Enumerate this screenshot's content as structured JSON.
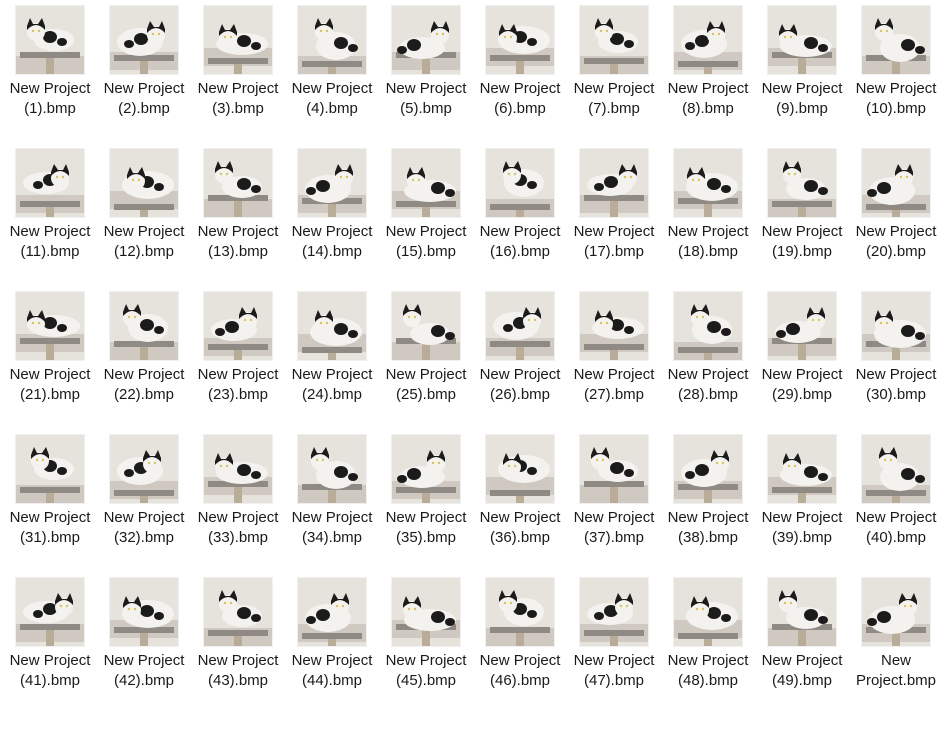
{
  "files": [
    {
      "name": "New Project (1).bmp",
      "thumb_icon": "cat-photo-icon"
    },
    {
      "name": "New Project (2).bmp",
      "thumb_icon": "cat-photo-icon"
    },
    {
      "name": "New Project (3).bmp",
      "thumb_icon": "cat-photo-icon"
    },
    {
      "name": "New Project (4).bmp",
      "thumb_icon": "cat-photo-icon"
    },
    {
      "name": "New Project (5).bmp",
      "thumb_icon": "cat-photo-icon"
    },
    {
      "name": "New Project (6).bmp",
      "thumb_icon": "cat-photo-icon"
    },
    {
      "name": "New Project (7).bmp",
      "thumb_icon": "cat-photo-icon"
    },
    {
      "name": "New Project (8).bmp",
      "thumb_icon": "cat-photo-icon"
    },
    {
      "name": "New Project (9).bmp",
      "thumb_icon": "cat-photo-icon"
    },
    {
      "name": "New Project (10).bmp",
      "thumb_icon": "cat-photo-icon"
    },
    {
      "name": "New Project (11).bmp",
      "thumb_icon": "cat-photo-icon"
    },
    {
      "name": "New Project (12).bmp",
      "thumb_icon": "cat-photo-icon"
    },
    {
      "name": "New Project (13).bmp",
      "thumb_icon": "cat-photo-icon"
    },
    {
      "name": "New Project (14).bmp",
      "thumb_icon": "cat-photo-icon"
    },
    {
      "name": "New Project (15).bmp",
      "thumb_icon": "cat-photo-icon"
    },
    {
      "name": "New Project (16).bmp",
      "thumb_icon": "cat-photo-icon"
    },
    {
      "name": "New Project (17).bmp",
      "thumb_icon": "cat-photo-icon"
    },
    {
      "name": "New Project (18).bmp",
      "thumb_icon": "cat-photo-icon"
    },
    {
      "name": "New Project (19).bmp",
      "thumb_icon": "cat-photo-icon"
    },
    {
      "name": "New Project (20).bmp",
      "thumb_icon": "cat-photo-icon"
    },
    {
      "name": "New Project (21).bmp",
      "thumb_icon": "cat-photo-icon"
    },
    {
      "name": "New Project (22).bmp",
      "thumb_icon": "cat-photo-icon"
    },
    {
      "name": "New Project (23).bmp",
      "thumb_icon": "cat-photo-icon"
    },
    {
      "name": "New Project (24).bmp",
      "thumb_icon": "cat-photo-icon"
    },
    {
      "name": "New Project (25).bmp",
      "thumb_icon": "cat-photo-icon"
    },
    {
      "name": "New Project (26).bmp",
      "thumb_icon": "cat-photo-icon"
    },
    {
      "name": "New Project (27).bmp",
      "thumb_icon": "cat-photo-icon"
    },
    {
      "name": "New Project (28).bmp",
      "thumb_icon": "cat-photo-icon"
    },
    {
      "name": "New Project (29).bmp",
      "thumb_icon": "cat-photo-icon"
    },
    {
      "name": "New Project (30).bmp",
      "thumb_icon": "cat-photo-icon"
    },
    {
      "name": "New Project (31).bmp",
      "thumb_icon": "cat-photo-icon"
    },
    {
      "name": "New Project (32).bmp",
      "thumb_icon": "cat-photo-icon"
    },
    {
      "name": "New Project (33).bmp",
      "thumb_icon": "cat-photo-icon"
    },
    {
      "name": "New Project (34).bmp",
      "thumb_icon": "cat-photo-icon"
    },
    {
      "name": "New Project (35).bmp",
      "thumb_icon": "cat-photo-icon"
    },
    {
      "name": "New Project (36).bmp",
      "thumb_icon": "cat-photo-icon"
    },
    {
      "name": "New Project (37).bmp",
      "thumb_icon": "cat-photo-icon"
    },
    {
      "name": "New Project (38).bmp",
      "thumb_icon": "cat-photo-icon"
    },
    {
      "name": "New Project (39).bmp",
      "thumb_icon": "cat-photo-icon"
    },
    {
      "name": "New Project (40).bmp",
      "thumb_icon": "cat-photo-icon"
    },
    {
      "name": "New Project (41).bmp",
      "thumb_icon": "cat-photo-icon"
    },
    {
      "name": "New Project (42).bmp",
      "thumb_icon": "cat-photo-icon"
    },
    {
      "name": "New Project (43).bmp",
      "thumb_icon": "cat-photo-icon"
    },
    {
      "name": "New Project (44).bmp",
      "thumb_icon": "cat-photo-icon"
    },
    {
      "name": "New Project (45).bmp",
      "thumb_icon": "cat-photo-icon"
    },
    {
      "name": "New Project (46).bmp",
      "thumb_icon": "cat-photo-icon"
    },
    {
      "name": "New Project (47).bmp",
      "thumb_icon": "cat-photo-icon"
    },
    {
      "name": "New Project (48).bmp",
      "thumb_icon": "cat-photo-icon"
    },
    {
      "name": "New Project (49).bmp",
      "thumb_icon": "cat-photo-icon"
    },
    {
      "name": "New Project.bmp",
      "thumb_icon": "cat-photo-icon"
    }
  ],
  "colors": {
    "wall": "#e6e2dc",
    "shelf": "#8f8a84",
    "cat_white": "#f4f2ef",
    "cat_black": "#1b1b1b",
    "label_text": "#1a1a1a"
  }
}
